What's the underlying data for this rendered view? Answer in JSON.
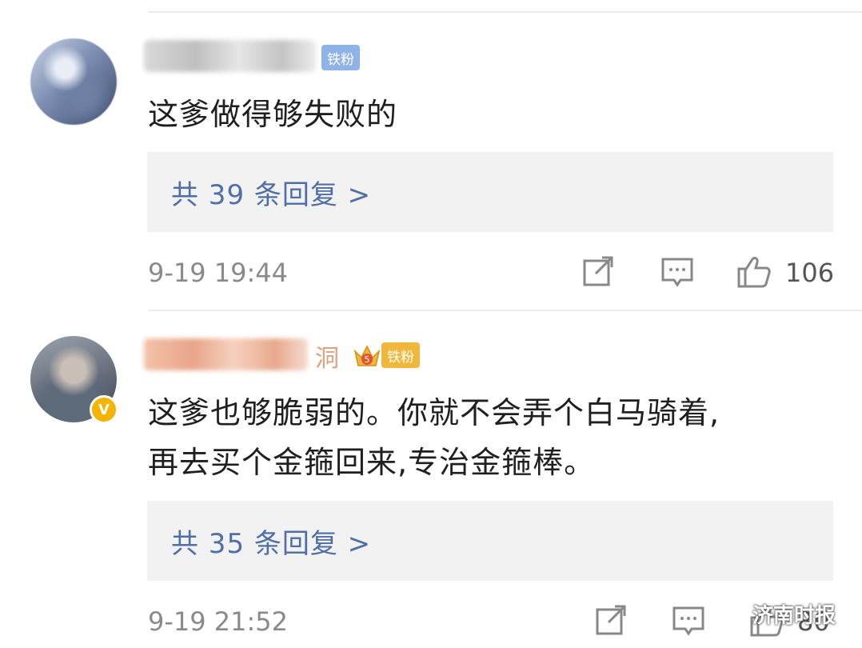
{
  "comments": [
    {
      "badge": "铁粉",
      "text": "这爹做得够失败的",
      "replies_label": "共 39 条回复 >",
      "time": "9-19 19:44",
      "likes": "106"
    },
    {
      "username_visible": "洞",
      "crown_level": "5",
      "badge": "铁粉",
      "verified_mark": "V",
      "text_lines": [
        "这爹也够脆弱的。你就不会弄个白马骑着,",
        "再去买个金箍回来,专治金箍棒。"
      ],
      "replies_label": "共 35 条回复 >",
      "time": "9-19 21:52",
      "likes": "80"
    }
  ],
  "watermark": {
    "text": "济南时报",
    "icon": "wechat-icon"
  },
  "icons": [
    "share-icon",
    "comment-icon",
    "thumbs-up-icon"
  ],
  "colors": {
    "link": "#4f6fa6",
    "badge_blue": "#8fb3e6",
    "badge_gold": "#f0b73a",
    "verified": "#f4b400"
  }
}
